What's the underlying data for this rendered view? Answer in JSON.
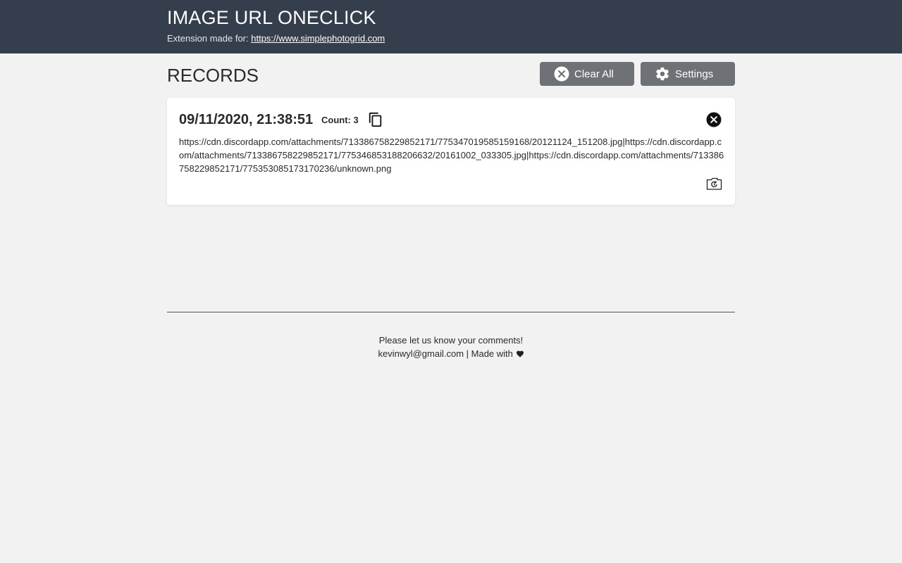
{
  "header": {
    "title": "IMAGE URL ONECLICK",
    "subtitle_prefix": "Extension made for: ",
    "subtitle_link": "https://www.simplephotogrid.com"
  },
  "records": {
    "title": "RECORDS",
    "clear_all_label": "Clear All",
    "settings_label": "Settings"
  },
  "record": {
    "date": "09/11/2020, 21:38:51",
    "count_label": "Count: 3",
    "urls": "https://cdn.discordapp.com/attachments/713386758229852171/775347019585159168/20121124_151208.jpg|https://cdn.discordapp.com/attachments/713386758229852171/775346853188206632/20161002_033305.jpg|https://cdn.discordapp.com/attachments/713386758229852171/775353085173170236/unknown.png"
  },
  "footer": {
    "line1": "Please let us know your comments!",
    "email": "kevinwyl@gmail.com",
    "made_with": " | Made with "
  },
  "icons": {
    "clear": "close-circle-icon",
    "settings": "gear-icon",
    "copy": "copy-icon",
    "delete": "close-circle-icon",
    "restore": "folder-restore-icon",
    "heart": "heart-icon"
  },
  "colors": {
    "header_bg": "#343e4c",
    "button_bg": "#6e7175",
    "page_bg": "#f2f2f2"
  }
}
